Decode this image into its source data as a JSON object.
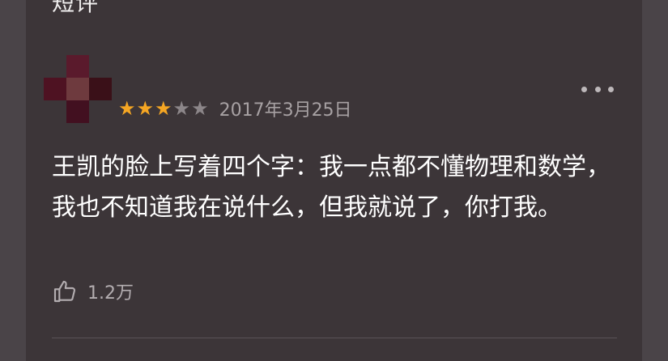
{
  "top_title_partial": "短评",
  "review": {
    "rating": 3,
    "max_rating": 5,
    "date": "2017年3月25日",
    "content": "王凯的脸上写着四个字：我一点都不懂物理和数学，我也不知道我在说什么，但我就说了，你打我。",
    "likes": "1.2万"
  },
  "icons": {
    "like": "thumbs-up-icon",
    "more": "more-options-icon",
    "star": "star-icon"
  },
  "colors": {
    "background": "#3c3538",
    "star_on": "#f5a623",
    "star_off": "#8c8689",
    "text": "#ffffff",
    "meta_text": "#a7a1a3"
  }
}
